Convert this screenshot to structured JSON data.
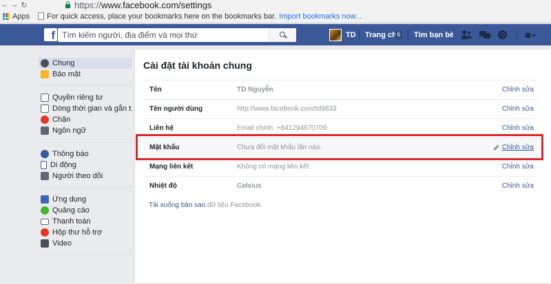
{
  "browser": {
    "url_scheme": "https://",
    "url_rest": "www.facebook.com/settings",
    "apps_label": "Apps",
    "bookmarks_hint": "For quick access, place your bookmarks here on the bookmarks bar.",
    "import_link": "Import bookmarks now..."
  },
  "header": {
    "logo": "f",
    "search_placeholder": "Tìm kiếm người, địa điểm và mọi thứ",
    "username": "TD",
    "home_label": "Trang chủ",
    "home_badge": "6",
    "friends_label": "Tìm bạn bè",
    "colors": {
      "bar": "#3b5998",
      "border": "#29487d"
    }
  },
  "sidebar": {
    "groups": [
      [
        {
          "label": "Chung",
          "icon": "gears-icon",
          "active": true
        },
        {
          "label": "Bảo mật",
          "icon": "security-badge-icon"
        }
      ],
      [
        {
          "label": "Quyền riêng tư",
          "icon": "privacy-lock-icon"
        },
        {
          "label": "Dòng thời gian và gắn t...",
          "icon": "timeline-icon"
        },
        {
          "label": "Chặn",
          "icon": "block-icon"
        },
        {
          "label": "Ngôn ngữ",
          "icon": "language-icon"
        }
      ],
      [
        {
          "label": "Thông báo",
          "icon": "notifications-globe-icon"
        },
        {
          "label": "Di động",
          "icon": "mobile-icon"
        },
        {
          "label": "Người theo dõi",
          "icon": "rss-icon"
        }
      ],
      [
        {
          "label": "Ứng dụng",
          "icon": "apps-icon"
        },
        {
          "label": "Quảng cáo",
          "icon": "ads-icon"
        },
        {
          "label": "Thanh toán",
          "icon": "payment-card-icon"
        },
        {
          "label": "Hộp thư hỗ trợ",
          "icon": "support-inbox-icon"
        },
        {
          "label": "Video",
          "icon": "video-icon"
        }
      ]
    ]
  },
  "main": {
    "title": "Cài đặt tài khoản chung",
    "rows": [
      {
        "label": "Tên",
        "value": "TD Nguyễn",
        "bold": true,
        "edit": "Chỉnh sửa"
      },
      {
        "label": "Tên người dùng",
        "value": "http://www.facebook.com/td9833",
        "bold": false,
        "edit": "Chỉnh sửa"
      },
      {
        "label": "Liên hệ",
        "value": "Email chính: +841294670709",
        "bold": false,
        "edit": "Chỉnh sửa"
      },
      {
        "label": "Mật khẩu",
        "value": "Chưa đổi mật khẩu lần nào.",
        "bold": false,
        "edit": "Chỉnh sửa",
        "highlight": true
      },
      {
        "label": "Mạng liên kết",
        "value": "Không có mạng liên kết.",
        "bold": false,
        "edit": "Chỉnh sửa"
      },
      {
        "label": "Nhiệt độ",
        "value": "Celsius",
        "bold": true,
        "edit": "Chỉnh sửa"
      }
    ],
    "download_link": "Tải xuống bản sao",
    "download_rest": " dữ liệu Facebook.",
    "annotation_color": "#e0262c"
  }
}
